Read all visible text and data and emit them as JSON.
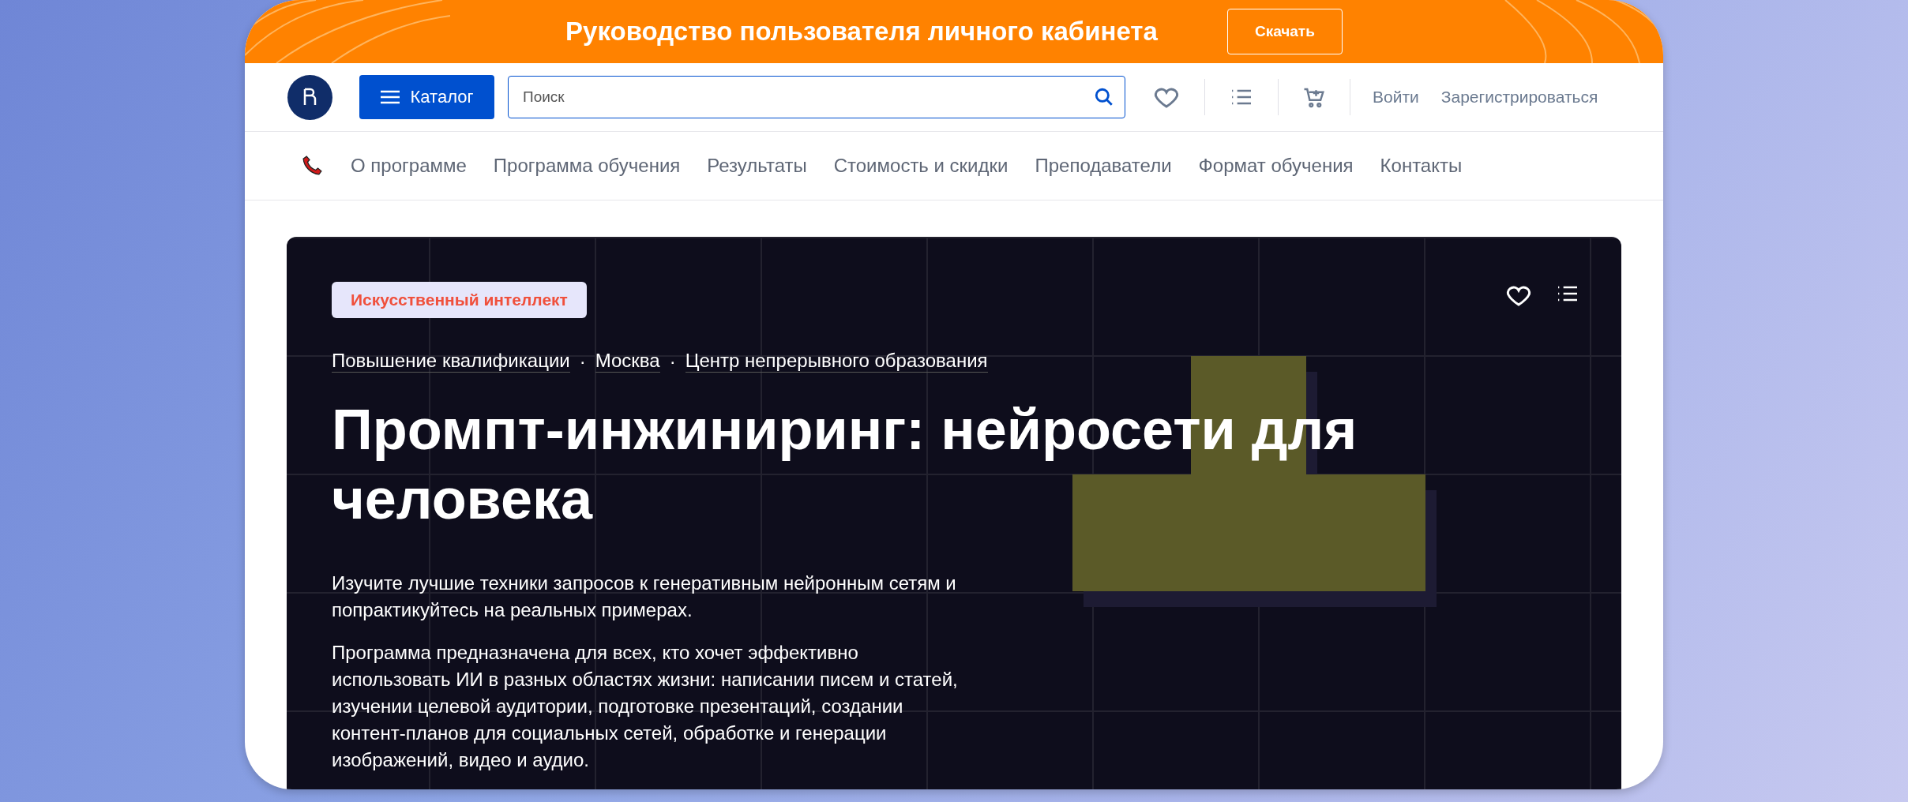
{
  "banner": {
    "title": "Руководство пользователя личного кабинета",
    "button": "Скачать"
  },
  "header": {
    "catalog_button": "Каталог",
    "search": {
      "placeholder": "Поиск"
    },
    "login": "Войти",
    "register": "Зарегистрироваться"
  },
  "nav": {
    "items": [
      "О программе",
      "Программа обучения",
      "Результаты",
      "Стоимость и скидки",
      "Преподаватели",
      "Формат обучения",
      "Контакты"
    ]
  },
  "hero": {
    "tag": "Искусственный интеллект",
    "separator": "·",
    "breadcrumbs": [
      "Повышение квалификации",
      "Москва",
      "Центр непрерывного образования"
    ],
    "title": "Промпт-инжиниринг: нейросети для человека",
    "paragraphs": [
      "Изучите лучшие техники запросов к генеративным нейронным сетям и попрактикуйтесь на реальных примерах.",
      "Программа предназначена для всех, кто хочет эффективно использовать ИИ в разных областях жизни: написании писем и статей, изучении целевой аудитории, подготовке презентаций, создании контент-планов для социальных сетей, обработке и генерации изображений, видео и аудио."
    ]
  }
}
